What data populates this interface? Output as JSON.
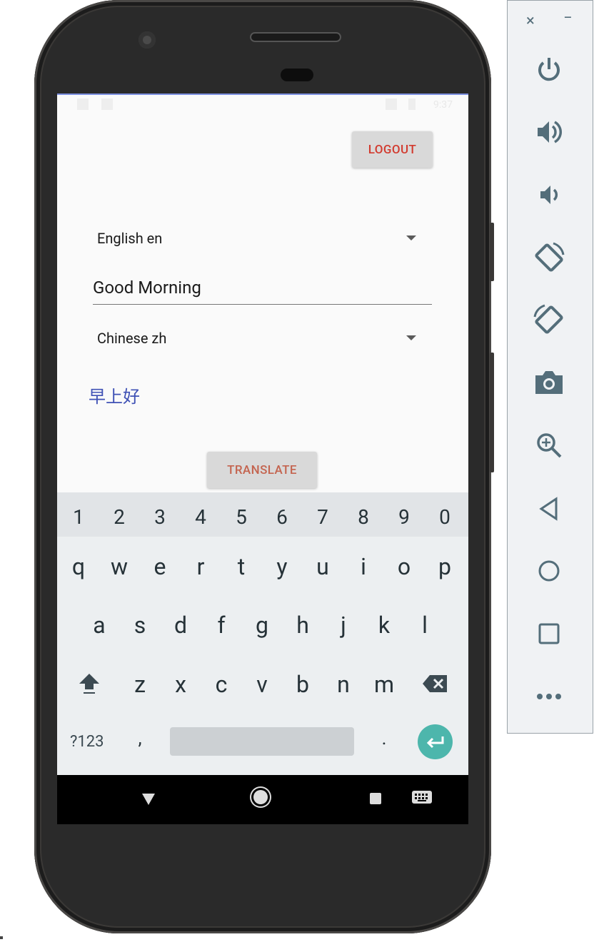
{
  "app": {
    "logout_label": "LOGOUT",
    "source_language": "English en",
    "input_text": "Good Morning",
    "target_language": "Chinese zh",
    "translated_text": "早上好",
    "translate_label": "TRANSLATE",
    "accent_color": "#3f51b5",
    "button_text_color": "#d23a2e"
  },
  "status_bar": {
    "time": "9:37"
  },
  "keyboard": {
    "numbers": [
      "1",
      "2",
      "3",
      "4",
      "5",
      "6",
      "7",
      "8",
      "9",
      "0"
    ],
    "row1": [
      "q",
      "w",
      "e",
      "r",
      "t",
      "y",
      "u",
      "i",
      "o",
      "p"
    ],
    "row2": [
      "a",
      "s",
      "d",
      "f",
      "g",
      "h",
      "j",
      "k",
      "l"
    ],
    "row3": [
      "z",
      "x",
      "c",
      "v",
      "b",
      "n",
      "m"
    ],
    "symbols_label": "?123",
    "comma": ",",
    "period": ".",
    "enter_color": "#4db6ac"
  },
  "emulator_panel": {
    "close": "×",
    "minimize": "−",
    "icons": [
      "power-icon",
      "volume-up-icon",
      "volume-down-icon",
      "rotate-left-icon",
      "rotate-right-icon",
      "camera-icon",
      "zoom-icon",
      "back-icon",
      "home-icon",
      "overview-icon",
      "more-icon"
    ],
    "icon_color": "#546e7a"
  }
}
